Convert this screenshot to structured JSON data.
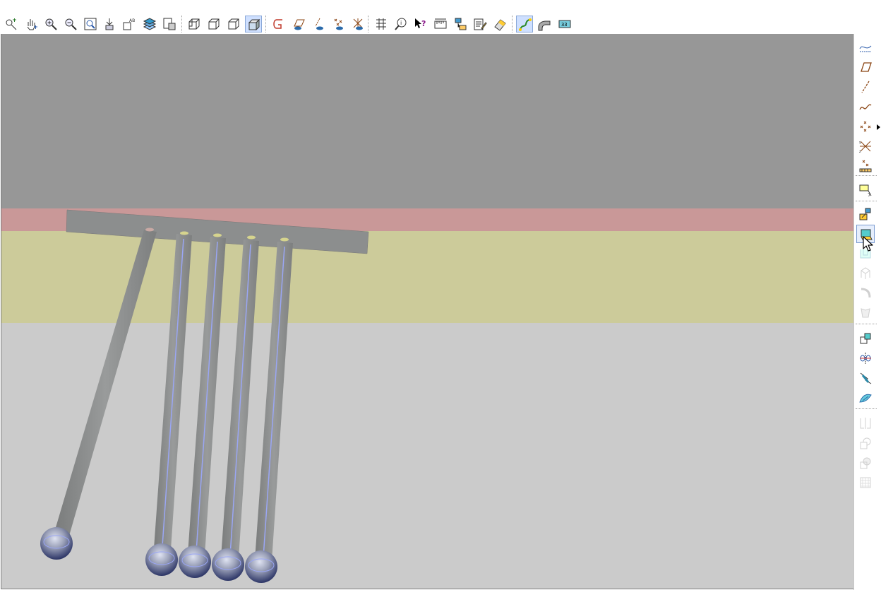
{
  "colors": {
    "sky": "#979797",
    "layer_pink": "#c99898",
    "layer_yellow": "#cccb9a",
    "ground": "#cbcbcb",
    "pile_body": "#8f9191",
    "pile_axis": "#9aa6f4",
    "cap": "#8c8e8e",
    "toolbar_active": "#cfe0ff"
  },
  "toolbar_top": {
    "buttons": [
      {
        "name": "select-filter-icon",
        "active": false
      },
      {
        "name": "pan-icon",
        "active": false
      },
      {
        "name": "zoom-in-icon",
        "active": false
      },
      {
        "name": "zoom-out-icon",
        "active": false
      },
      {
        "name": "zoom-window-icon",
        "active": false
      },
      {
        "name": "insert-point-icon",
        "active": false
      },
      {
        "name": "label-ab-icon",
        "active": false
      },
      {
        "name": "layers-icon",
        "active": false
      },
      {
        "name": "view-snapshot-icon",
        "active": false
      },
      {
        "name": "wireframe-cube-icon",
        "active": false
      },
      {
        "name": "hidden-line-cube-icon",
        "active": false
      },
      {
        "name": "flat-cube-icon",
        "active": false
      },
      {
        "name": "shaded-cube-icon",
        "active": true
      },
      {
        "name": "curve-g-icon",
        "active": false
      },
      {
        "name": "plane-eye-icon",
        "active": false
      },
      {
        "name": "line-eye-icon",
        "active": false
      },
      {
        "name": "points-eye-icon",
        "active": false
      },
      {
        "name": "axes-eye-icon",
        "active": false
      },
      {
        "name": "grid-mesh-icon",
        "active": false
      },
      {
        "name": "info-query-icon",
        "active": false
      },
      {
        "name": "what-is-this-icon",
        "active": false
      },
      {
        "name": "measure-icon",
        "active": false
      },
      {
        "name": "network-icon",
        "active": false
      },
      {
        "name": "report-edit-icon",
        "active": false
      },
      {
        "name": "eraser-icon",
        "active": false
      },
      {
        "name": "spline-active-icon",
        "active": true
      },
      {
        "name": "pipe-icon",
        "active": false
      },
      {
        "name": "coordinate-display-icon",
        "active": false
      }
    ]
  },
  "toolbar_right": {
    "buttons": [
      {
        "name": "surface-curve-icon",
        "enabled": true
      },
      {
        "name": "plane-icon",
        "enabled": true
      },
      {
        "name": "line-icon",
        "enabled": true
      },
      {
        "name": "curve-icon",
        "enabled": true
      },
      {
        "name": "point-cross-icon",
        "enabled": true
      },
      {
        "name": "axis-system-icon",
        "enabled": true
      },
      {
        "name": "point-grid-icon",
        "enabled": true
      },
      {
        "name": "annotation-flag-icon",
        "enabled": true
      },
      {
        "name": "extrude-icon",
        "enabled": true
      },
      {
        "name": "solid-box-icon",
        "enabled": true
      },
      {
        "name": "pocket-icon",
        "enabled": false
      },
      {
        "name": "revolve-icon",
        "enabled": false
      },
      {
        "name": "sweep-icon",
        "enabled": false
      },
      {
        "name": "loft-icon",
        "enabled": false
      },
      {
        "name": "translate-copy-icon",
        "enabled": true
      },
      {
        "name": "mirror-axis-icon",
        "enabled": true
      },
      {
        "name": "rotate-icon",
        "enabled": true
      },
      {
        "name": "surface-icon",
        "enabled": true
      },
      {
        "name": "split-icon",
        "enabled": false
      },
      {
        "name": "boolean-union-icon",
        "enabled": false
      },
      {
        "name": "boolean-subtract-icon",
        "enabled": false
      },
      {
        "name": "mesh-grid-icon",
        "enabled": false
      }
    ]
  }
}
